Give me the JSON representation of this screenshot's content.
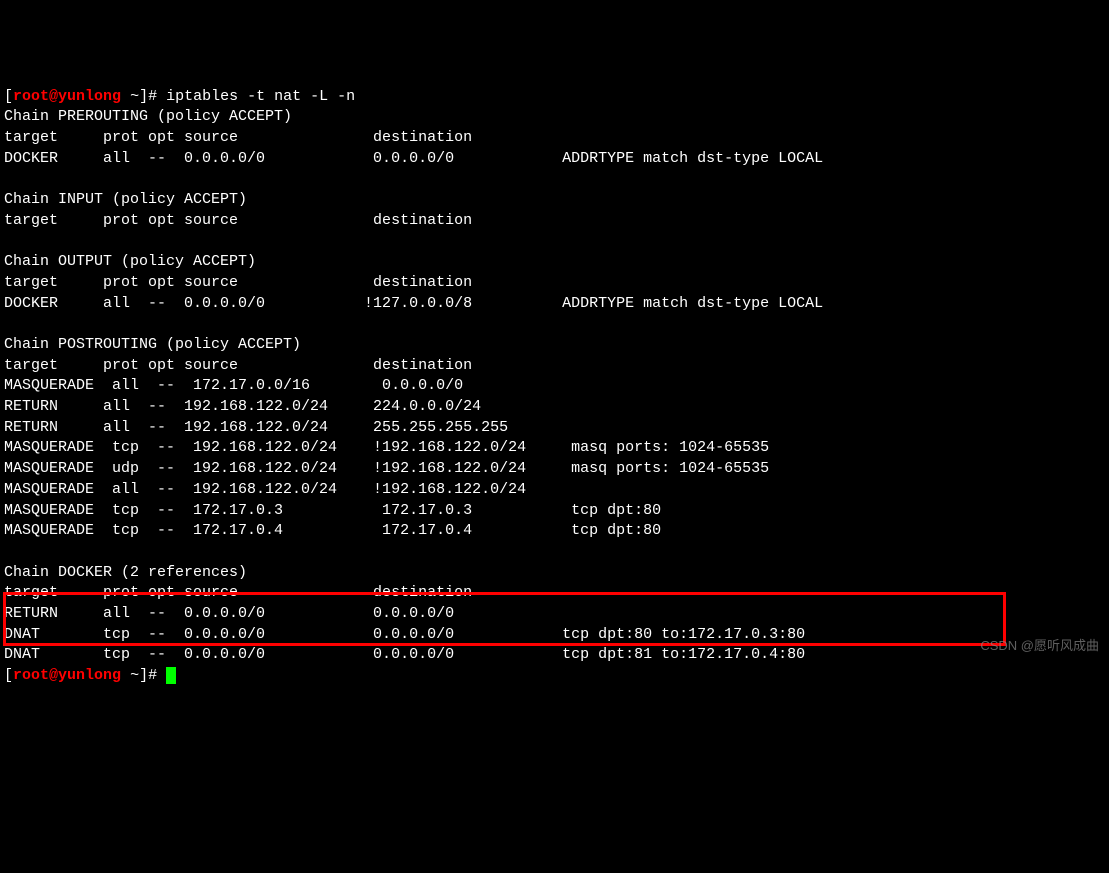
{
  "prompt": {
    "open": "[",
    "user": "root",
    "at": "@",
    "host": "yunlong",
    "tilde": " ~",
    "close": "]",
    "hash": "# "
  },
  "command1": "iptables -t nat -L -n",
  "chains": {
    "prerouting": {
      "header": "Chain PREROUTING (policy ACCEPT)",
      "cols": "target     prot opt source               destination         ",
      "rows": [
        "DOCKER     all  --  0.0.0.0/0            0.0.0.0/0            ADDRTYPE match dst-type LOCAL"
      ]
    },
    "input": {
      "header": "Chain INPUT (policy ACCEPT)",
      "cols": "target     prot opt source               destination         "
    },
    "output": {
      "header": "Chain OUTPUT (policy ACCEPT)",
      "cols": "target     prot opt source               destination         ",
      "rows": [
        "DOCKER     all  --  0.0.0.0/0           !127.0.0.0/8          ADDRTYPE match dst-type LOCAL"
      ]
    },
    "postrouting": {
      "header": "Chain POSTROUTING (policy ACCEPT)",
      "cols": "target     prot opt source               destination         ",
      "rows": [
        "MASQUERADE  all  --  172.17.0.0/16        0.0.0.0/0           ",
        "RETURN     all  --  192.168.122.0/24     224.0.0.0/24        ",
        "RETURN     all  --  192.168.122.0/24     255.255.255.255     ",
        "MASQUERADE  tcp  --  192.168.122.0/24    !192.168.122.0/24     masq ports: 1024-65535",
        "MASQUERADE  udp  --  192.168.122.0/24    !192.168.122.0/24     masq ports: 1024-65535",
        "MASQUERADE  all  --  192.168.122.0/24    !192.168.122.0/24    ",
        "MASQUERADE  tcp  --  172.17.0.3           172.17.0.3           tcp dpt:80",
        "MASQUERADE  tcp  --  172.17.0.4           172.17.0.4           tcp dpt:80"
      ]
    },
    "docker": {
      "header": "Chain DOCKER (2 references)",
      "cols": "target     prot opt source               destination         ",
      "rows": [
        "RETURN     all  --  0.0.0.0/0            0.0.0.0/0           ",
        "DNAT       tcp  --  0.0.0.0/0            0.0.0.0/0            tcp dpt:80 to:172.17.0.3:80",
        "DNAT       tcp  --  0.0.0.0/0            0.0.0.0/0            tcp dpt:81 to:172.17.0.4:80"
      ]
    }
  },
  "watermark": "CSDN @愿听风成曲"
}
